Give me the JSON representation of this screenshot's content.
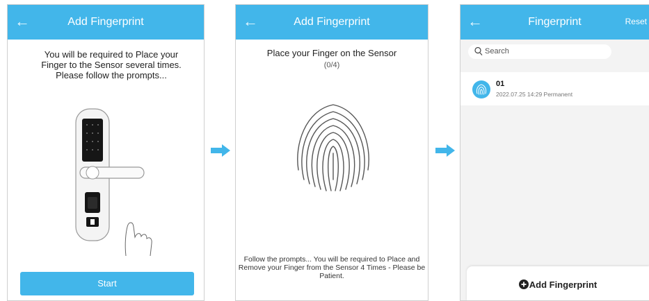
{
  "screen1": {
    "title": "Add Fingerprint",
    "instruction": "You will be required to Place your Finger to the Sensor several times. Please follow the prompts...",
    "start_button": "Start"
  },
  "screen2": {
    "title": "Add Fingerprint",
    "place_text": "Place your Finger on the Sensor",
    "progress": "(0/4)",
    "follow_text": "Follow the prompts... You will be required to Place and Remove your Finger from the Sensor 4 Times - Please be Patient."
  },
  "screen3": {
    "title": "Fingerprint",
    "reset": "Reset",
    "search_placeholder": "Search",
    "items": [
      {
        "name": "01",
        "meta": "2022.07.25 14:29   Permanent"
      }
    ],
    "add_button": "Add Fingerprint"
  },
  "icons": {
    "back": "back-arrow-icon",
    "search": "search-icon",
    "fingerprint": "fingerprint-icon",
    "add": "plus-circle-icon",
    "flow_arrow": "right-arrow-icon"
  },
  "colors": {
    "accent": "#42b6ea",
    "header_text": "#ffffff",
    "list_background": "#f3f3f3"
  }
}
